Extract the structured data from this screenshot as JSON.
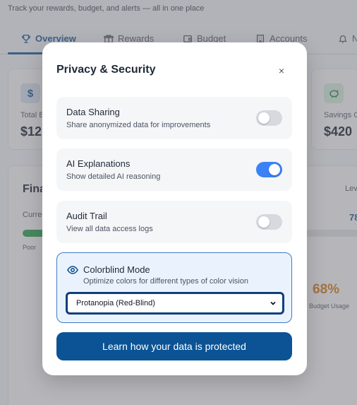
{
  "page": {
    "subtitle": "Track your rewards, budget, and alerts — all in one place"
  },
  "tabs": [
    {
      "label": "Overview",
      "icon": "trophy-icon",
      "active": true
    },
    {
      "label": "Rewards",
      "icon": "gift-icon",
      "active": false
    },
    {
      "label": "Budget",
      "icon": "wallet-icon",
      "active": false
    },
    {
      "label": "Accounts",
      "icon": "building-icon",
      "active": false
    },
    {
      "label": "N",
      "icon": "bell-icon",
      "active": false
    }
  ],
  "stats": {
    "left": {
      "icon": "dollar-icon",
      "label": "Total B",
      "value": "$12,"
    },
    "right": {
      "icon": "piggy-bank-icon",
      "label": "Savings G",
      "value": "$420"
    }
  },
  "financial": {
    "title": "Fina",
    "current_label": "Curren",
    "poor_label": "Poor",
    "level_label": "Lev",
    "level_value": "78",
    "budget_usage_value": "68%",
    "budget_usage_label": "Budget Usage"
  },
  "modal": {
    "title": "Privacy & Security",
    "close_label": "×",
    "settings": [
      {
        "title": "Data Sharing",
        "description": "Share anonymized data for improvements",
        "enabled": false
      },
      {
        "title": "AI Explanations",
        "description": "Show detailed AI reasoning",
        "enabled": true
      },
      {
        "title": "Audit Trail",
        "description": "View all data access logs",
        "enabled": false
      }
    ],
    "colorblind": {
      "icon": "eye-icon",
      "title": "Colorblind Mode",
      "description": "Optimize colors for different types of color vision",
      "selected": "Protanopia (Red-Blind)"
    },
    "learn_button": "Learn how your data is protected"
  },
  "colors": {
    "primary": "#0b5394",
    "toggle_on": "#3b82f6",
    "toggle_off": "#d6d9de",
    "success": "#22a34a",
    "warning": "#d97706"
  }
}
